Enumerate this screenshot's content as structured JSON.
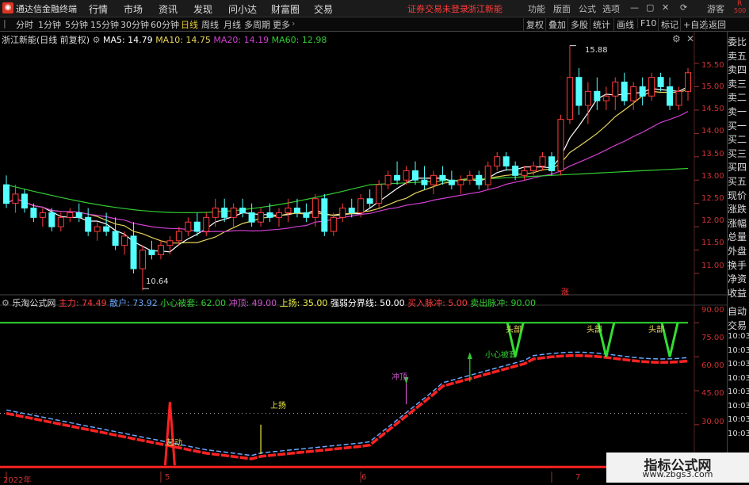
{
  "app": {
    "title": "通达信金融终端"
  },
  "menu": [
    "行情",
    "市场",
    "资讯",
    "发现",
    "问小达",
    "财富圈",
    "交易"
  ],
  "status_warning": "证券交易未登录",
  "stock_link": "浙江新能",
  "top_right": [
    "功能",
    "版面",
    "公式",
    "选项",
    "游客"
  ],
  "period_tabs": [
    "分时",
    "1分钟",
    "5分钟",
    "15分钟",
    "30分钟",
    "60分钟",
    "日线",
    "周线",
    "月线",
    "多周期",
    "更多"
  ],
  "active_tab": "日线",
  "toolbar_right": [
    "复权",
    "叠加",
    "多股",
    "统计",
    "画线",
    "F10",
    "标记",
    "+自选",
    "返回"
  ],
  "main_legend": {
    "name": "浙江新能",
    "note": "(日线 前复权)",
    "ma5": "MA5: 14.79",
    "ma10": "MA10: 14.75",
    "ma20": "MA20: 14.19",
    "ma60": "MA60: 12.98"
  },
  "price_axis": [
    "15.50",
    "15.00",
    "14.50",
    "14.00",
    "13.50",
    "13.00",
    "12.50",
    "12.00",
    "11.50",
    "11.00"
  ],
  "annotations": {
    "high": "15.88",
    "low": "10.64",
    "zhang": "涨"
  },
  "right_panel_top": [
    "委比",
    "卖五",
    "卖四",
    "卖三",
    "卖二",
    "卖一",
    "买一",
    "买二",
    "买三",
    "买四",
    "买五",
    "现价",
    "涨跌",
    "涨幅",
    "总量",
    "外盘",
    "换手",
    "净资",
    "收益"
  ],
  "right_panel_bottom": [
    "自动",
    "交易",
    "10:03",
    "10:03",
    "10:03",
    "10:03",
    "10:03",
    "10:03",
    "10:03",
    "10:03"
  ],
  "r_label": "R",
  "r_value": "500",
  "indicator_legend": {
    "name": "乐淘公式网",
    "items": [
      "主力: 74.49",
      "散户: 73.92",
      "小心被套: 62.00",
      "冲顶: 49.00",
      "上扬: 35.00",
      "强弱分界线: 50.00",
      "买入脉冲: 5.00",
      "卖出脉冲: 90.00"
    ]
  },
  "ind_axis": [
    "90.00",
    "75.00",
    "60.00",
    "45.00",
    "30.00"
  ],
  "ind_labels": {
    "top": "头部",
    "careful": "小心被套",
    "peak": "冲顶",
    "rise": "上扬",
    "start": "起动"
  },
  "date_labels": [
    "2022年",
    "5",
    "6",
    "7"
  ],
  "watermark": {
    "title": "指标公式网",
    "url": "www.zbgs3.com"
  },
  "chart_data": {
    "type": "candlestick",
    "series": [
      {
        "name": "MA5",
        "color": "#ffffff"
      },
      {
        "name": "MA10",
        "color": "#e6d35a"
      },
      {
        "name": "MA20",
        "color": "#d040d0"
      },
      {
        "name": "MA60",
        "color": "#33cc33"
      }
    ],
    "ylim": [
      10.6,
      15.9
    ],
    "candles": [
      [
        12.9,
        13.1,
        12.4,
        12.5
      ],
      [
        12.5,
        12.9,
        12.3,
        12.7
      ],
      [
        12.7,
        12.8,
        12.3,
        12.4
      ],
      [
        12.4,
        12.5,
        12.1,
        12.2
      ],
      [
        12.2,
        12.4,
        12.0,
        12.3
      ],
      [
        12.3,
        12.4,
        11.9,
        12.0
      ],
      [
        12.0,
        12.3,
        11.9,
        12.2
      ],
      [
        12.2,
        12.4,
        12.1,
        12.3
      ],
      [
        12.3,
        12.5,
        12.1,
        12.2
      ],
      [
        12.2,
        12.4,
        11.8,
        11.9
      ],
      [
        11.9,
        12.1,
        11.7,
        12.0
      ],
      [
        12.0,
        12.3,
        11.8,
        11.9
      ],
      [
        11.9,
        12.2,
        11.5,
        11.6
      ],
      [
        11.6,
        11.9,
        11.4,
        11.8
      ],
      [
        11.8,
        12.1,
        11.0,
        11.1
      ],
      [
        11.1,
        11.6,
        10.64,
        11.5
      ],
      [
        11.5,
        11.7,
        11.3,
        11.4
      ],
      [
        11.4,
        11.7,
        11.3,
        11.6
      ],
      [
        11.6,
        11.8,
        11.4,
        11.7
      ],
      [
        11.7,
        12.0,
        11.6,
        11.9
      ],
      [
        11.9,
        12.2,
        11.8,
        12.1
      ],
      [
        12.1,
        12.3,
        11.8,
        11.9
      ],
      [
        11.9,
        12.3,
        11.8,
        12.2
      ],
      [
        12.2,
        12.6,
        12.0,
        12.4
      ],
      [
        12.4,
        12.6,
        12.1,
        12.2
      ],
      [
        12.2,
        12.5,
        12.0,
        12.4
      ],
      [
        12.4,
        12.6,
        12.2,
        12.3
      ],
      [
        12.3,
        12.5,
        12.0,
        12.1
      ],
      [
        12.1,
        12.4,
        12.0,
        12.3
      ],
      [
        12.3,
        12.5,
        12.1,
        12.2
      ],
      [
        12.2,
        12.4,
        12.0,
        12.3
      ],
      [
        12.3,
        12.6,
        12.1,
        12.4
      ],
      [
        12.4,
        12.6,
        12.2,
        12.3
      ],
      [
        12.3,
        12.5,
        12.1,
        12.2
      ],
      [
        12.2,
        12.7,
        12.0,
        12.6
      ],
      [
        12.6,
        12.7,
        11.8,
        11.9
      ],
      [
        11.9,
        12.3,
        11.8,
        12.2
      ],
      [
        12.2,
        12.5,
        12.1,
        12.4
      ],
      [
        12.4,
        12.6,
        12.2,
        12.3
      ],
      [
        12.3,
        12.7,
        12.2,
        12.6
      ],
      [
        12.6,
        12.8,
        12.4,
        12.5
      ],
      [
        12.5,
        13.0,
        12.4,
        12.9
      ],
      [
        12.9,
        13.2,
        12.8,
        13.1
      ],
      [
        13.1,
        13.4,
        12.9,
        13.0
      ],
      [
        13.0,
        13.3,
        12.9,
        13.2
      ],
      [
        13.2,
        13.4,
        12.9,
        13.0
      ],
      [
        13.0,
        13.3,
        12.8,
        12.9
      ],
      [
        12.9,
        13.2,
        12.7,
        13.1
      ],
      [
        13.1,
        13.3,
        12.9,
        13.0
      ],
      [
        13.0,
        13.2,
        12.8,
        12.9
      ],
      [
        12.9,
        13.1,
        12.7,
        13.0
      ],
      [
        13.0,
        13.2,
        12.9,
        13.1
      ],
      [
        13.1,
        13.2,
        12.8,
        12.9
      ],
      [
        12.9,
        13.4,
        12.8,
        13.3
      ],
      [
        13.3,
        13.6,
        13.2,
        13.5
      ],
      [
        13.5,
        13.6,
        13.2,
        13.3
      ],
      [
        13.3,
        13.4,
        13.0,
        13.1
      ],
      [
        13.1,
        13.3,
        13.0,
        13.2
      ],
      [
        13.2,
        13.4,
        13.1,
        13.3
      ],
      [
        13.3,
        13.6,
        13.2,
        13.5
      ],
      [
        13.5,
        13.6,
        13.1,
        13.2
      ],
      [
        13.2,
        14.4,
        13.1,
        14.3
      ],
      [
        14.3,
        15.88,
        14.2,
        15.2
      ],
      [
        15.2,
        15.4,
        14.4,
        14.6
      ],
      [
        14.6,
        15.1,
        14.2,
        14.9
      ],
      [
        14.9,
        15.2,
        14.5,
        14.7
      ],
      [
        14.7,
        15.0,
        14.5,
        14.8
      ],
      [
        14.8,
        15.2,
        14.5,
        15.1
      ],
      [
        15.1,
        15.3,
        14.6,
        14.7
      ],
      [
        14.7,
        15.1,
        14.5,
        15.0
      ],
      [
        15.0,
        15.2,
        14.6,
        14.8
      ],
      [
        14.8,
        15.3,
        14.7,
        15.2
      ],
      [
        15.2,
        15.3,
        14.9,
        15.0
      ],
      [
        15.0,
        15.2,
        14.5,
        14.6
      ],
      [
        14.6,
        15.0,
        14.5,
        14.9
      ],
      [
        14.9,
        15.4,
        14.7,
        15.3
      ]
    ],
    "indicator_range": [
      25,
      95
    ]
  }
}
